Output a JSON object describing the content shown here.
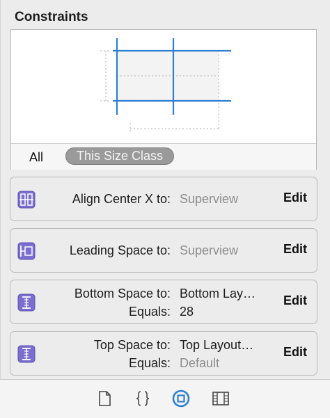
{
  "header": {
    "title": "Constraints"
  },
  "scope": {
    "all_label": "All",
    "size_class_label": "This Size Class"
  },
  "constraints": [
    {
      "icon": "align-center-x-icon",
      "label1": "Align Center X to:",
      "value1": "Superview",
      "label2": "",
      "value2": "",
      "edit": "Edit"
    },
    {
      "icon": "leading-space-icon",
      "label1": "Leading Space to:",
      "value1": "Superview",
      "label2": "",
      "value2": "",
      "edit": "Edit"
    },
    {
      "icon": "bottom-space-icon",
      "label1": "Bottom Space to:",
      "value1": "Bottom Lay…",
      "label2": "Equals:",
      "value2": "28",
      "edit": "Edit"
    },
    {
      "icon": "top-space-icon",
      "label1": "Top Space to:",
      "value1": "Top Layout…",
      "label2": "Equals:",
      "value2": "Default",
      "edit": "Edit"
    }
  ],
  "inspector_tabs": [
    "file-inspector-icon",
    "quick-help-icon",
    "identity-inspector-icon",
    "size-inspector-icon"
  ],
  "colors": {
    "accent": "#2f7fd1",
    "icon_purple": "#7a6fd0"
  }
}
